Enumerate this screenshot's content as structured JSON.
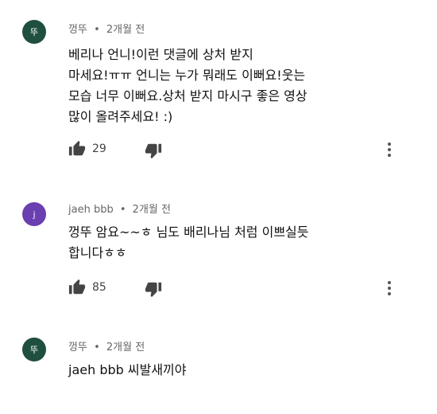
{
  "comments": [
    {
      "avatar_letter": "뚜",
      "avatar_color": "#1f4f3f",
      "author": "껑뚜",
      "separator": "•",
      "time": "2개월 전",
      "text": "베리나 언니!이런 댓글에 상처 받지\n마세요!ㅠㅠ 언니는 누가 뭐래도 이뻐요!웃는\n모습 너무 이뻐요.상처 받지 마시구 좋은 영상\n많이 올려주세요! :)",
      "likes": "29",
      "like_icon": "thumbs-up-icon",
      "dislike_icon": "thumbs-down-icon",
      "more_icon": "more-vertical-icon"
    },
    {
      "avatar_letter": "j",
      "avatar_color": "#6a3fb0",
      "author": "jaeh bbb",
      "separator": "•",
      "time": "2개월 전",
      "text": "껑뚜 암요~~ㅎ 님도 배리나님 처럼 이쁘실듯\n합니다ㅎㅎ",
      "likes": "85",
      "like_icon": "thumbs-up-icon",
      "dislike_icon": "thumbs-down-icon",
      "more_icon": "more-vertical-icon"
    },
    {
      "avatar_letter": "뚜",
      "avatar_color": "#1f4f3f",
      "author": "껑뚜",
      "separator": "•",
      "time": "2개월 전",
      "text": "jaeh bbb 씨발새끼야"
    }
  ]
}
